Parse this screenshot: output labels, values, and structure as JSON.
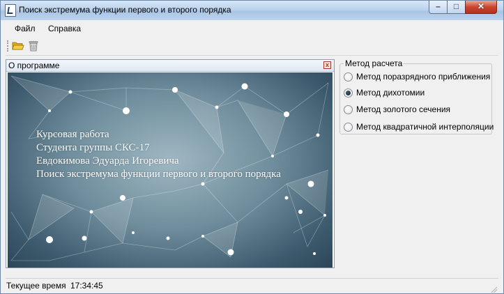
{
  "window": {
    "title": "Поиск экстремума функции первого и второго порядка",
    "controls": {
      "minimize": "–",
      "maximize": "□",
      "close": "✕"
    }
  },
  "menu": {
    "items": [
      "Файл",
      "Справка"
    ]
  },
  "toolbar": {
    "icons": [
      "open-folder-icon",
      "delete-trash-icon"
    ]
  },
  "about": {
    "title": "О программе",
    "close_glyph": "x",
    "lines": [
      "Курсовая работа",
      "Студента группы СКС-17",
      "Евдокимова Эдуарда Игоревича",
      "Поиск экстремума функции первого и второго порядка"
    ]
  },
  "method": {
    "legend": "Метод расчета",
    "options": [
      {
        "label": "Метод поразрядного приближения",
        "checked": false
      },
      {
        "label": "Метод дихотомии",
        "checked": true
      },
      {
        "label": "Метод золотого сечения",
        "checked": false
      },
      {
        "label": "Метод квадратичной интерполяции",
        "checked": false
      }
    ]
  },
  "status": {
    "label": "Текущее время",
    "time": "17:34:45"
  },
  "colors": {
    "title_gradient_top": "#d6e6f7",
    "title_gradient_bottom": "#a9c4e4",
    "close_button": "#c8452e",
    "about_background": "#5e7c8c"
  }
}
